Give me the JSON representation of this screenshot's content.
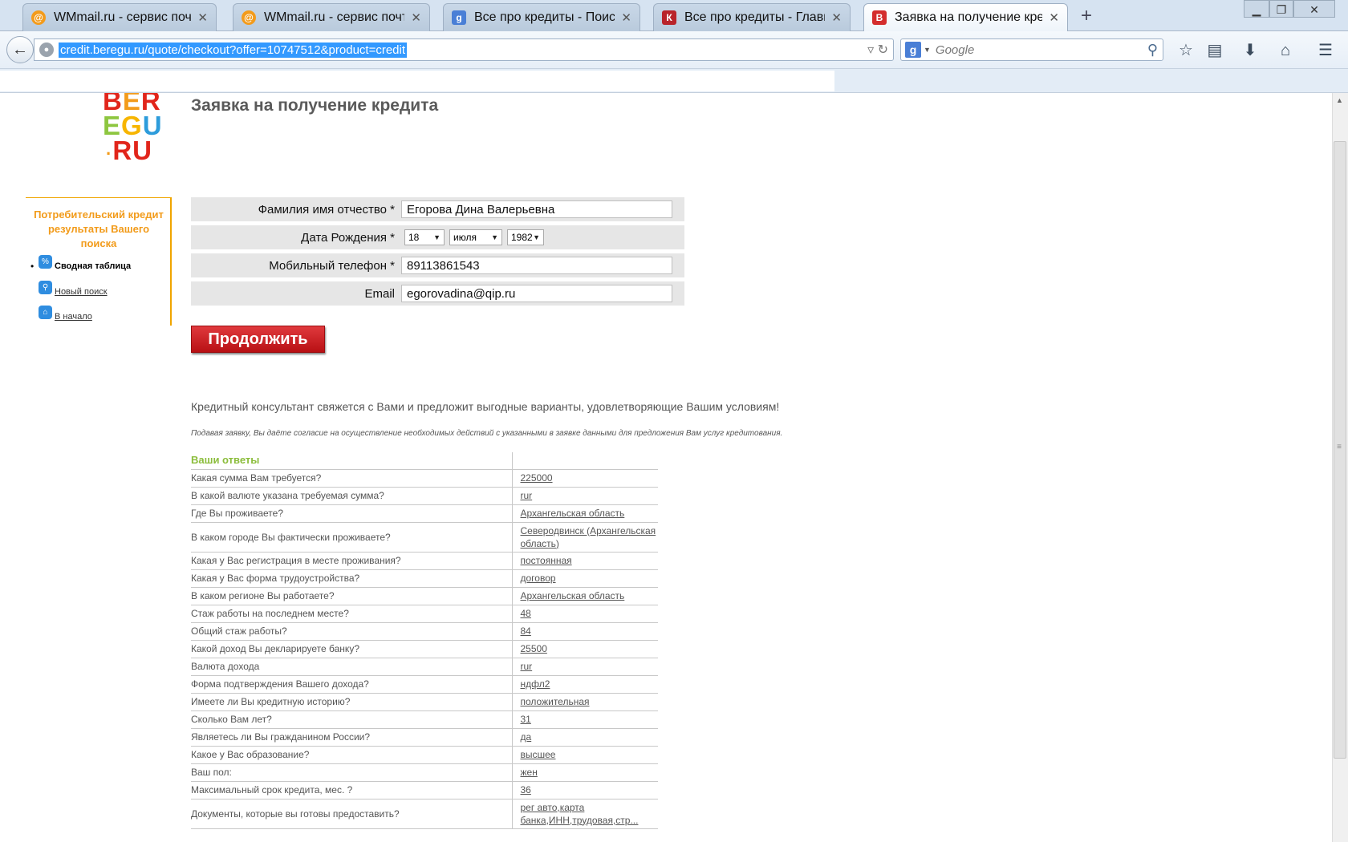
{
  "browser": {
    "tabs": [
      {
        "label": "WMmail.ru - сервис почто...",
        "icon": "wmmail-icon",
        "active": false
      },
      {
        "label": "WMmail.ru - сервис почто...",
        "icon": "wmmail-icon",
        "active": false
      },
      {
        "label": "Все про кредиты - Поиск ...",
        "icon": "google-icon",
        "active": false
      },
      {
        "label": "Все про кредиты - Главная",
        "icon": "credit-site-icon",
        "active": false
      },
      {
        "label": "Заявка на получение кре...",
        "icon": "beregu-icon",
        "active": true
      }
    ],
    "url": "credit.beregu.ru/quote/checkout?offer=10747512&product=credit",
    "search_engine": "Google",
    "search_placeholder": "Google"
  },
  "logo": {
    "line1": "BER",
    "line2": "EGU",
    "line3": "·RU"
  },
  "page_title": "Заявка на получение кредита",
  "sidebar": {
    "title": "Потребительский кредит результаты Вашего поиска",
    "items": [
      {
        "label": "Сводная таблица",
        "icon": "percent-icon"
      },
      {
        "label": "Новый поиск",
        "icon": "search-icon"
      },
      {
        "label": "В начало",
        "icon": "home-icon"
      }
    ]
  },
  "form": {
    "fio_label": "Фамилия имя отчество *",
    "fio_value": "Егорова Дина Валерьевна",
    "dob_label": "Дата Рождения *",
    "dob_day": "18",
    "dob_month": "июля",
    "dob_year": "1982",
    "phone_label": "Мобильный телефон *",
    "phone_value": "89113861543",
    "email_label": "Email",
    "email_value": "egorovadina@qip.ru",
    "submit_label": "Продолжить"
  },
  "consult_text": "Кредитный консультант свяжется с Вами и предложит выгодные варианты, удовлетворяющие Вашим условиям!",
  "consent_text": "Подавая заявку, Вы даёте согласие на осуществление необходимых действий с указанными в заявке данными для предложения Вам услуг кредитования.",
  "answers": {
    "header": "Ваши ответы",
    "rows": [
      {
        "q": "Какая сумма Вам требуется?",
        "a": "225000"
      },
      {
        "q": "В какой валюте указана требуемая сумма?",
        "a": "rur"
      },
      {
        "q": "Где Вы проживаете?",
        "a": "Архангельская область"
      },
      {
        "q": "В каком городе Вы фактически проживаете?",
        "a": "Северодвинск (Архангельская область)"
      },
      {
        "q": "Какая у Вас регистрация в месте проживания?",
        "a": "постоянная"
      },
      {
        "q": "Какая у Вас форма трудоустройства?",
        "a": "договор"
      },
      {
        "q": "В каком регионе Вы работаете?",
        "a": "Архангельская область"
      },
      {
        "q": "Стаж работы на последнем месте?",
        "a": "48"
      },
      {
        "q": "Общий стаж работы?",
        "a": "84"
      },
      {
        "q": "Какой доход Вы декларируете банку?",
        "a": "25500"
      },
      {
        "q": "Валюта дохода",
        "a": "rur"
      },
      {
        "q": "Форма подтверждения Вашего дохода?",
        "a": "ндфл2"
      },
      {
        "q": "Имеете ли Вы кредитную историю?",
        "a": "положительная"
      },
      {
        "q": "Сколько Вам лет?",
        "a": "31"
      },
      {
        "q": "Являетесь ли Вы гражданином России?",
        "a": "да"
      },
      {
        "q": "Какое у Вас образование?",
        "a": "высшее"
      },
      {
        "q": "Ваш пол:",
        "a": "жен"
      },
      {
        "q": "Максимальный срок кредита, мес. ?",
        "a": "36"
      },
      {
        "q": "Документы, которые вы готовы предоставить?",
        "a": "рег авто,карта банка,ИНН,трудовая,стр..."
      }
    ]
  },
  "colors": {
    "accent_orange": "#f29b1a",
    "button_red": "#c8191d",
    "answers_header_green": "#8bbd3b"
  }
}
